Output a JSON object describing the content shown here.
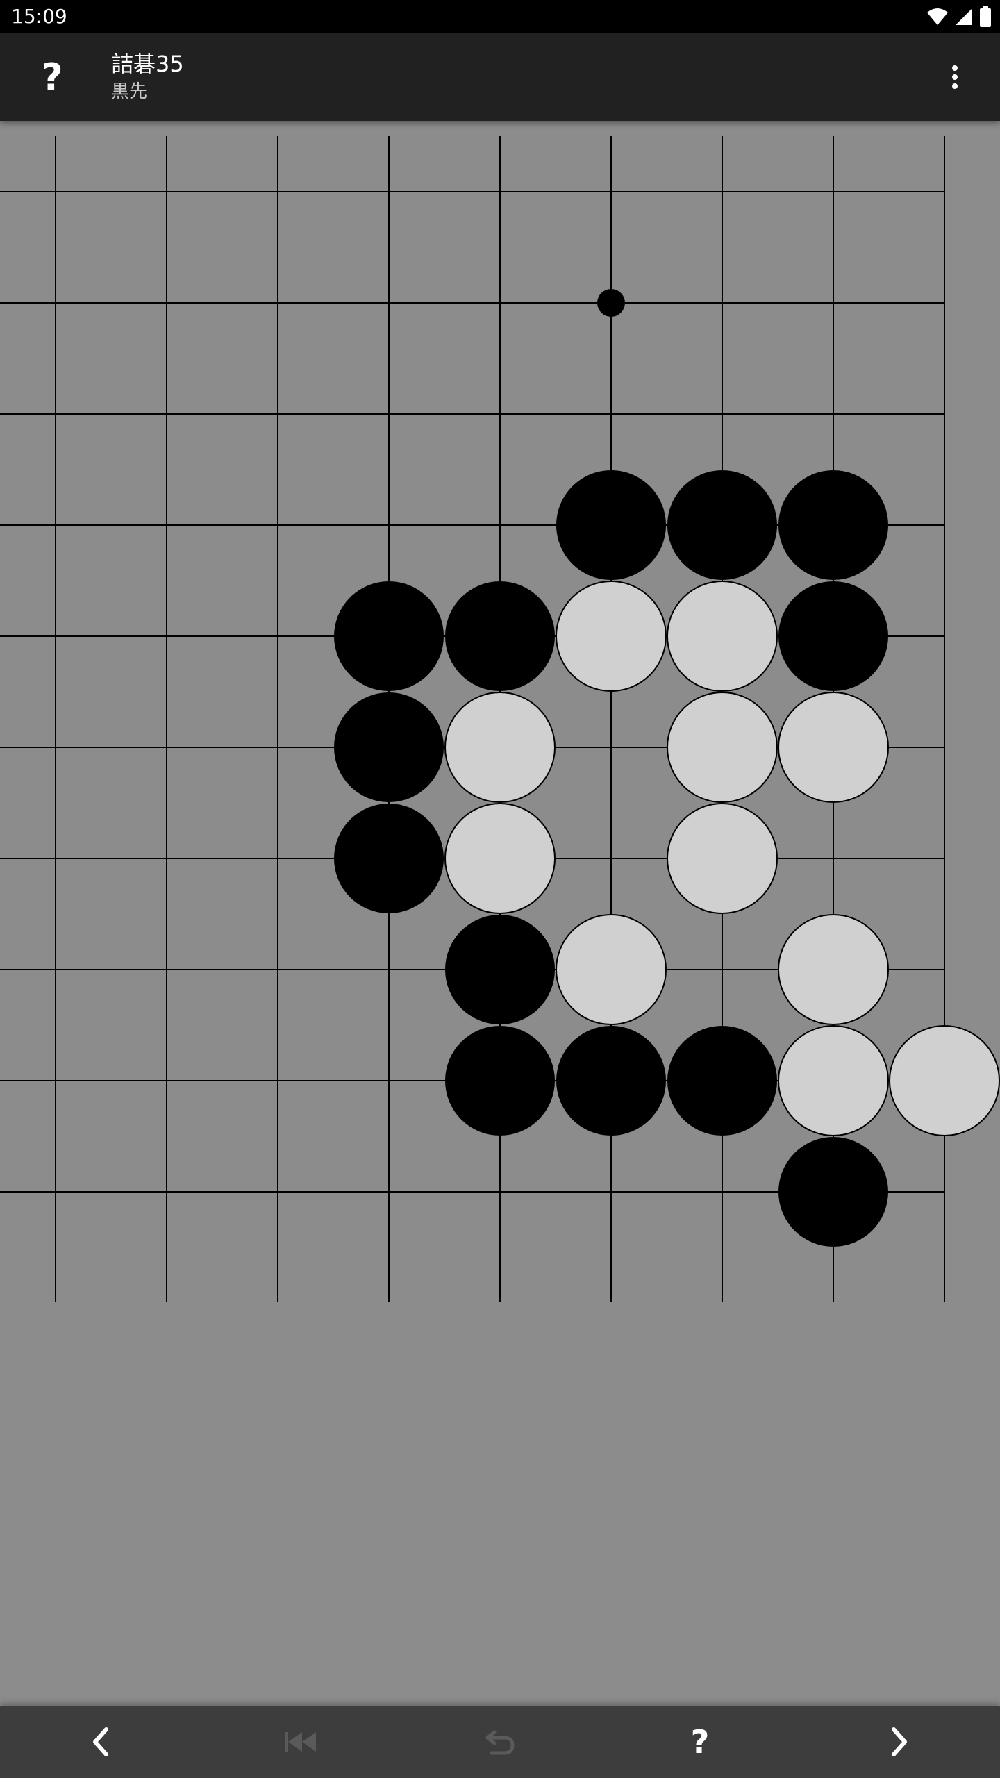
{
  "status_bar": {
    "time": "15:09",
    "icons": [
      "wifi-icon",
      "cell-signal-icon",
      "battery-icon"
    ]
  },
  "app_bar": {
    "help_icon_glyph": "?",
    "title": "詰碁35",
    "subtitle": "黒先",
    "more_icon": "more-vert-icon",
    "background_color": "#212121"
  },
  "board": {
    "visible_columns": 9,
    "visible_rows": 11,
    "background_color": "#8c8c8c",
    "line_color": "#000000",
    "black_stone_color": "#000000",
    "white_stone_color": "#d0d0d0",
    "star_points": [
      [
        5,
        1
      ]
    ],
    "stones": [
      {
        "col": 5,
        "row": 3,
        "color": "black"
      },
      {
        "col": 6,
        "row": 3,
        "color": "black"
      },
      {
        "col": 7,
        "row": 3,
        "color": "black"
      },
      {
        "col": 3,
        "row": 4,
        "color": "black"
      },
      {
        "col": 4,
        "row": 4,
        "color": "black"
      },
      {
        "col": 5,
        "row": 4,
        "color": "white"
      },
      {
        "col": 6,
        "row": 4,
        "color": "white"
      },
      {
        "col": 7,
        "row": 4,
        "color": "black"
      },
      {
        "col": 3,
        "row": 5,
        "color": "black"
      },
      {
        "col": 4,
        "row": 5,
        "color": "white"
      },
      {
        "col": 6,
        "row": 5,
        "color": "white"
      },
      {
        "col": 7,
        "row": 5,
        "color": "white"
      },
      {
        "col": 3,
        "row": 6,
        "color": "black"
      },
      {
        "col": 4,
        "row": 6,
        "color": "white"
      },
      {
        "col": 6,
        "row": 6,
        "color": "white"
      },
      {
        "col": 4,
        "row": 7,
        "color": "black"
      },
      {
        "col": 5,
        "row": 7,
        "color": "white"
      },
      {
        "col": 7,
        "row": 7,
        "color": "white"
      },
      {
        "col": 4,
        "row": 8,
        "color": "black"
      },
      {
        "col": 5,
        "row": 8,
        "color": "black"
      },
      {
        "col": 6,
        "row": 8,
        "color": "black"
      },
      {
        "col": 7,
        "row": 8,
        "color": "white"
      },
      {
        "col": 8,
        "row": 8,
        "color": "white"
      },
      {
        "col": 7,
        "row": 9,
        "color": "black"
      }
    ]
  },
  "bottom_bar": {
    "background_color": "#3d3d3d",
    "buttons": [
      {
        "icon": "chevron-left-icon",
        "enabled": true
      },
      {
        "icon": "skip-to-start-icon",
        "enabled": false
      },
      {
        "icon": "undo-icon",
        "enabled": false
      },
      {
        "icon": "hint-question-icon",
        "glyph": "?",
        "enabled": true
      },
      {
        "icon": "chevron-right-icon",
        "enabled": true
      }
    ]
  }
}
